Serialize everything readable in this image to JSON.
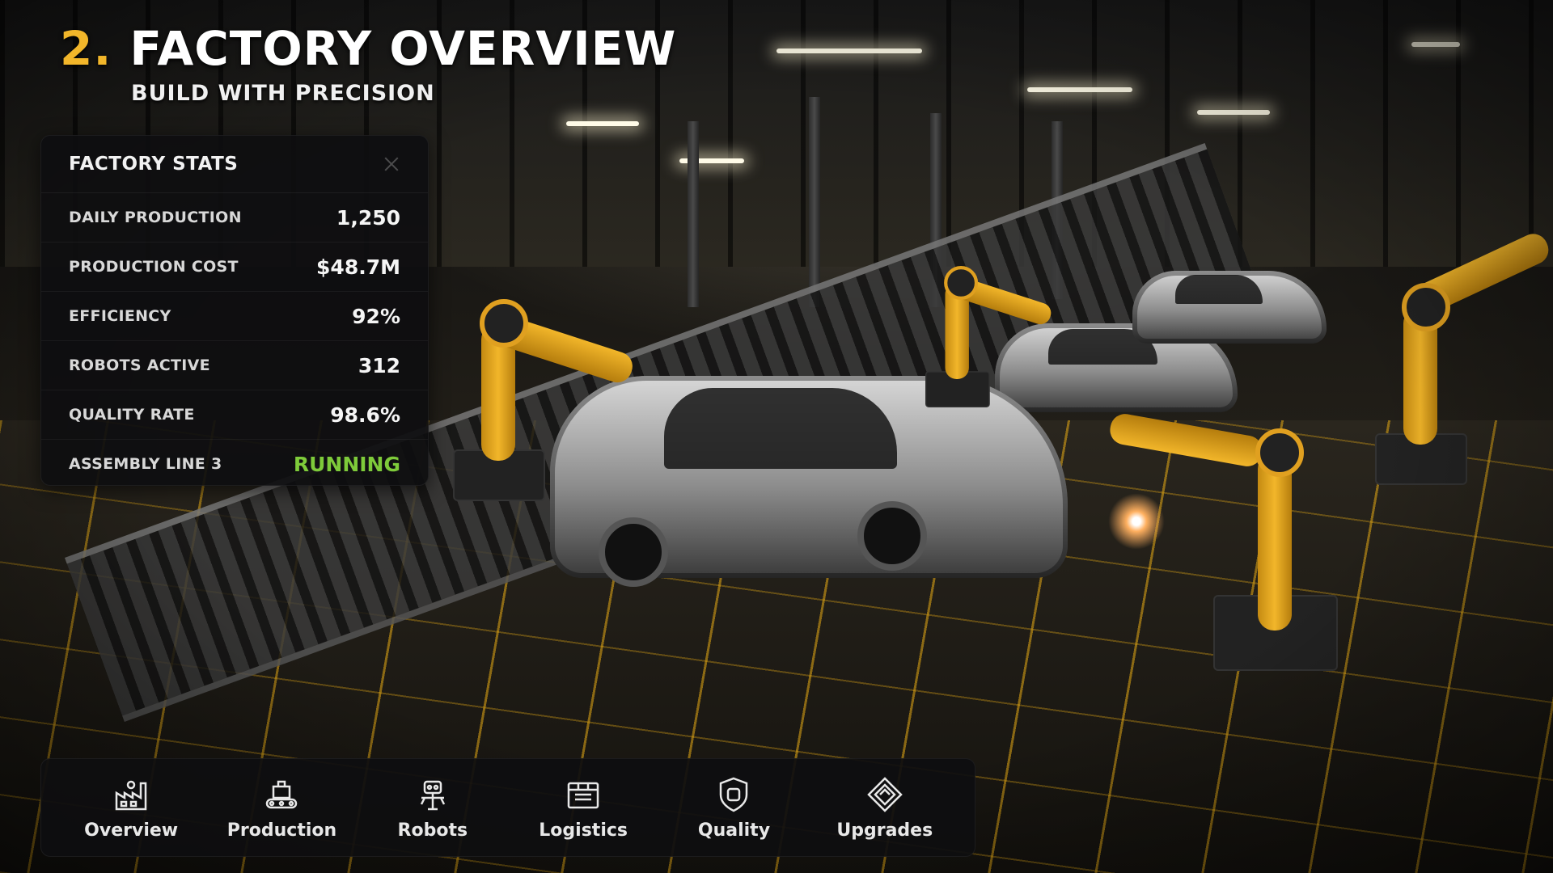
{
  "header": {
    "number": "2.",
    "title": "FACTORY OVERVIEW",
    "subtitle": "BUILD WITH PRECISION"
  },
  "stats_panel": {
    "title": "FACTORY STATS",
    "rows": [
      {
        "label": "DAILY PRODUCTION",
        "value": "1,250"
      },
      {
        "label": "PRODUCTION COST",
        "value": "$48.7M"
      },
      {
        "label": "EFFICIENCY",
        "value": "92%"
      },
      {
        "label": "ROBOTS ACTIVE",
        "value": "312"
      },
      {
        "label": "QUALITY RATE",
        "value": "98.6%"
      },
      {
        "label": "ASSEMBLY LINE 3",
        "value": "RUNNING"
      }
    ]
  },
  "nav": {
    "items": [
      {
        "label": "Overview",
        "icon": "factory-icon"
      },
      {
        "label": "Production",
        "icon": "conveyor-icon"
      },
      {
        "label": "Robots",
        "icon": "robot-icon"
      },
      {
        "label": "Logistics",
        "icon": "crate-icon"
      },
      {
        "label": "Quality",
        "icon": "shield-icon"
      },
      {
        "label": "Upgrades",
        "icon": "upgrade-icon"
      }
    ]
  },
  "colors": {
    "accent": "#f2b62a",
    "status_ok": "#7ecb3a",
    "panel_bg": "#0e0e10"
  }
}
